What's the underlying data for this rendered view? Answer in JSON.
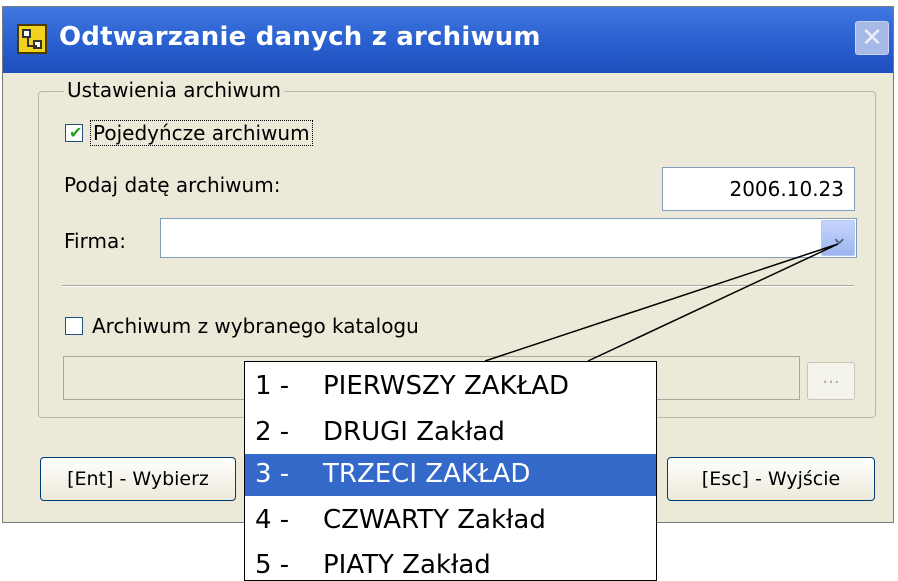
{
  "window": {
    "title": "Odtwarzanie danych z archiwum",
    "close_symbol": "✕"
  },
  "group": {
    "legend": "Ustawienia archiwum"
  },
  "single_archive": {
    "label": "Pojedyńcze archiwum",
    "checked": true
  },
  "date": {
    "label": "Podaj datę archiwum:",
    "value": "2006.10.23"
  },
  "firma": {
    "label": "Firma:",
    "value": ""
  },
  "catalog_archive": {
    "label": "Archiwum z wybranego katalogu",
    "checked": false
  },
  "path": {
    "value": "",
    "browse_label": "..."
  },
  "buttons": {
    "select": "[Ent] - Wybierz",
    "exit": "[Esc] - Wyjście"
  },
  "dropdown_items": [
    {
      "num": "1  -",
      "name": "PIERWSZY ZAKŁAD",
      "selected": false
    },
    {
      "num": "2  -",
      "name": "DRUGI Zakład",
      "selected": false
    },
    {
      "num": "3  -",
      "name": "TRZECI ZAKŁAD",
      "selected": true
    },
    {
      "num": "4  -",
      "name": "CZWARTY Zakład",
      "selected": false
    },
    {
      "num": "5  -",
      "name": "PIATY Zakład",
      "selected": false
    }
  ],
  "colors": {
    "titlebar": "#2a5fcf",
    "window_bg": "#ece9d8",
    "selection": "#3569c9"
  }
}
